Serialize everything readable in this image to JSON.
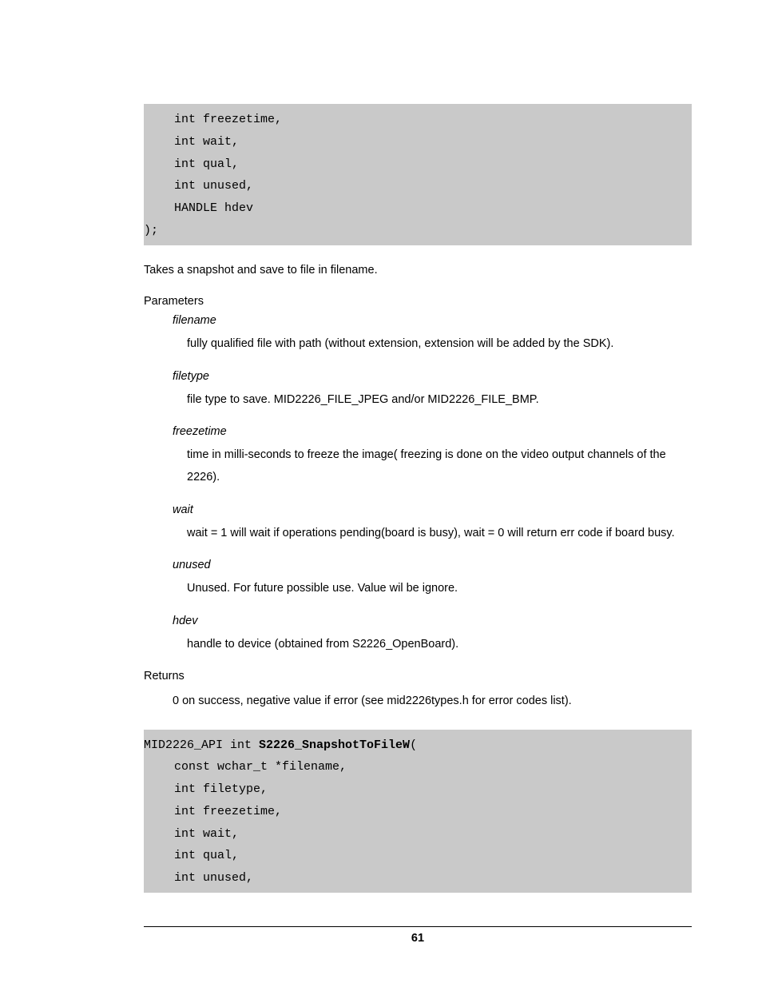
{
  "code1": {
    "lines": [
      "int freezetime,",
      "int wait,",
      "int qual,",
      "int unused,",
      "HANDLE hdev"
    ],
    "close": ");"
  },
  "intro": "Takes a snapshot and save to file in filename.",
  "params_label": "Parameters",
  "params": [
    {
      "name": "filename",
      "desc": "fully qualified file with path (without extension, extension will be added by the SDK)."
    },
    {
      "name": "filetype",
      "desc": "file type to save.  MID2226_FILE_JPEG and/or MID2226_FILE_BMP."
    },
    {
      "name": "freezetime",
      "desc": "time in milli-seconds to freeze the image( freezing is done on the video output channels of the 2226)."
    },
    {
      "name": "wait",
      "desc": "wait = 1 will wait if operations pending(board is busy), wait = 0 will return err code if board busy."
    },
    {
      "name": "unused",
      "desc": "Unused.  For future possible use. Value wil be ignore."
    },
    {
      "name": "hdev",
      "desc": "handle to device (obtained from S2226_OpenBoard)."
    }
  ],
  "returns_label": "Returns",
  "returns_desc": "0 on success, negative value if error (see mid2226types.h for error codes list).",
  "code2": {
    "sig_prefix": "MID2226_API int ",
    "sig_name": "S2226_SnapshotToFileW",
    "sig_open": "(",
    "lines": [
      "const wchar_t *filename,",
      "int filetype,",
      "int freezetime,",
      "int wait,",
      "int qual,",
      "int unused,"
    ]
  },
  "page_number": "61"
}
